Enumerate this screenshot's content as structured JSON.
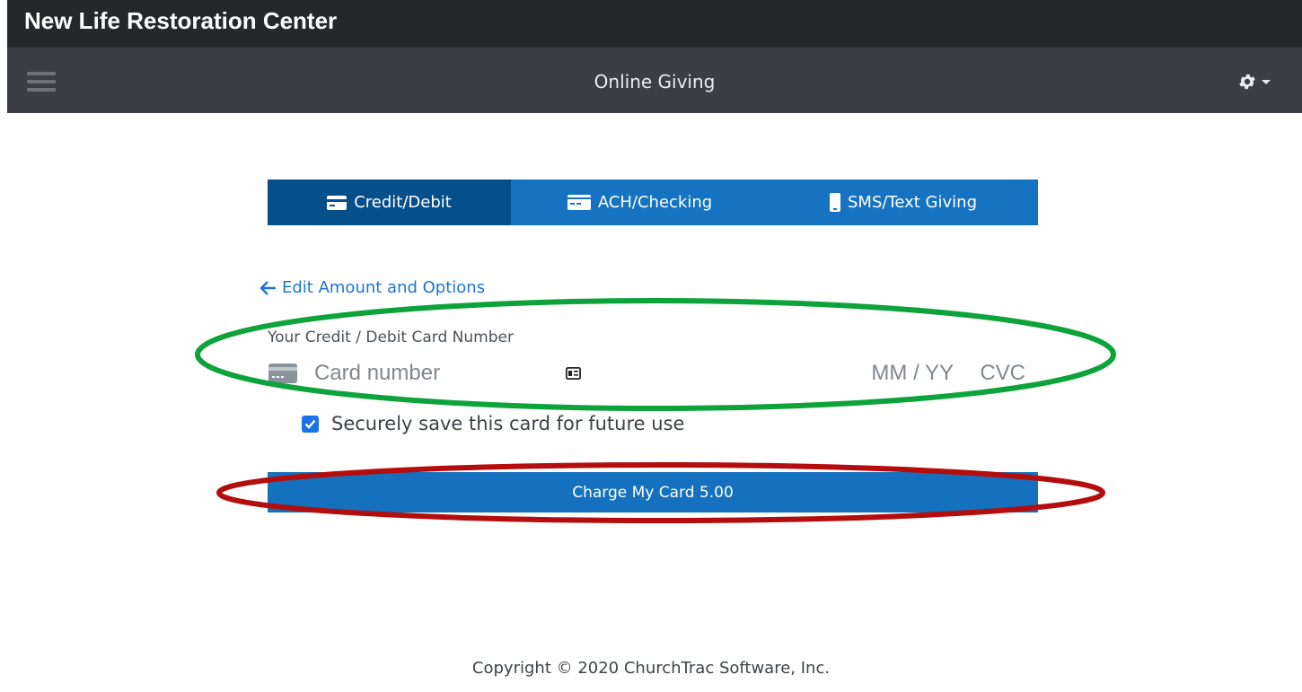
{
  "header": {
    "org_name": "New Life Restoration Center"
  },
  "navbar": {
    "title": "Online Giving",
    "menu_icon": "hamburger-icon",
    "settings_icon": "gear-icon"
  },
  "tabs": [
    {
      "label": "Credit/Debit",
      "icon": "credit-card-icon",
      "active": true
    },
    {
      "label": "ACH/Checking",
      "icon": "check-card-icon",
      "active": false
    },
    {
      "label": "SMS/Text Giving",
      "icon": "phone-icon",
      "active": false
    }
  ],
  "payment": {
    "back_link": "Edit Amount and Options",
    "card_label": "Your Credit / Debit Card Number",
    "card_placeholder": "Card number",
    "exp_placeholder": "MM / YY",
    "cvc_placeholder": "CVC",
    "save_card_label": "Securely save this card for future use",
    "save_card_checked": true,
    "charge_button": "Charge My Card 5.00"
  },
  "footer": {
    "copyright": "Copyright © 2020 ChurchTrac Software, Inc."
  },
  "colors": {
    "topbar": "#25272b",
    "navbar": "#3b3f45",
    "tab_active": "#05508a",
    "tab_inactive": "#1573c2",
    "annotation_green": "#0da33a",
    "annotation_red": "#b40d0d"
  }
}
